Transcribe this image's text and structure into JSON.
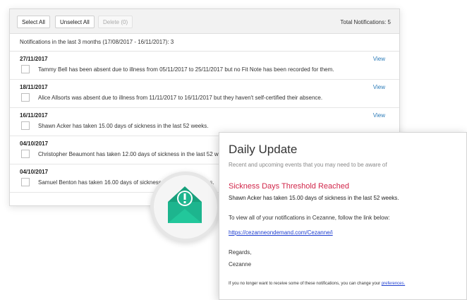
{
  "toolbar": {
    "select_all": "Select All",
    "unselect_all": "Unselect All",
    "delete": "Delete (0)",
    "total": "Total Notifications: 5"
  },
  "summary": "Notifications in the last 3 months (17/08/2017 - 16/11/2017): 3",
  "view_label": "View",
  "notifications": [
    {
      "date": "27/11/2017",
      "message": "Tammy Bell has been absent due to illness from 05/11/2017 to 25/11/2017 but no Fit Note has been recorded for them.",
      "view": "View"
    },
    {
      "date": "18/11/2017",
      "message": "Alice Allsorts was absent due to illness from 11/11/2017 to 16/11/2017 but they haven't self-certified their absence.",
      "view": "View"
    },
    {
      "date": "16/11/2017",
      "message": "Shawn Acker has taken 15.00 days of sickness in the last 52 weeks.",
      "view": "View"
    },
    {
      "date": "04/10/2017",
      "message": "Christopher Beaumont has taken 12.00 days of sickness in the last 52 weeks.",
      "view": ""
    },
    {
      "date": "04/10/2017",
      "message": "Samuel Benton has taken 16.00 days of sickness in the last 52 weeks.",
      "view": ""
    }
  ],
  "email": {
    "title": "Daily Update",
    "subtitle": "Recent and upcoming events that you may need to be aware of",
    "heading": "Sickness Days Threshold Reached",
    "detail": "Shawn Acker has taken 15.00 days of sickness in the last 52 weeks.",
    "text": "To view all of your notifications in Cezanne, follow the link below:",
    "link": "https://cezanneondemand.com/Cezanne/i",
    "regards": "Regards,",
    "signature": "Cezanne",
    "footer": "If you no longer want to receive some of these notifications, you can change your",
    "footer_link": "preferences."
  },
  "colors": {
    "envelope": "#1db58e",
    "link": "#1f3fd0",
    "heading": "#d1264a",
    "view": "#2a7ab8"
  },
  "icons": {
    "badge": "envelope-alert-icon"
  }
}
